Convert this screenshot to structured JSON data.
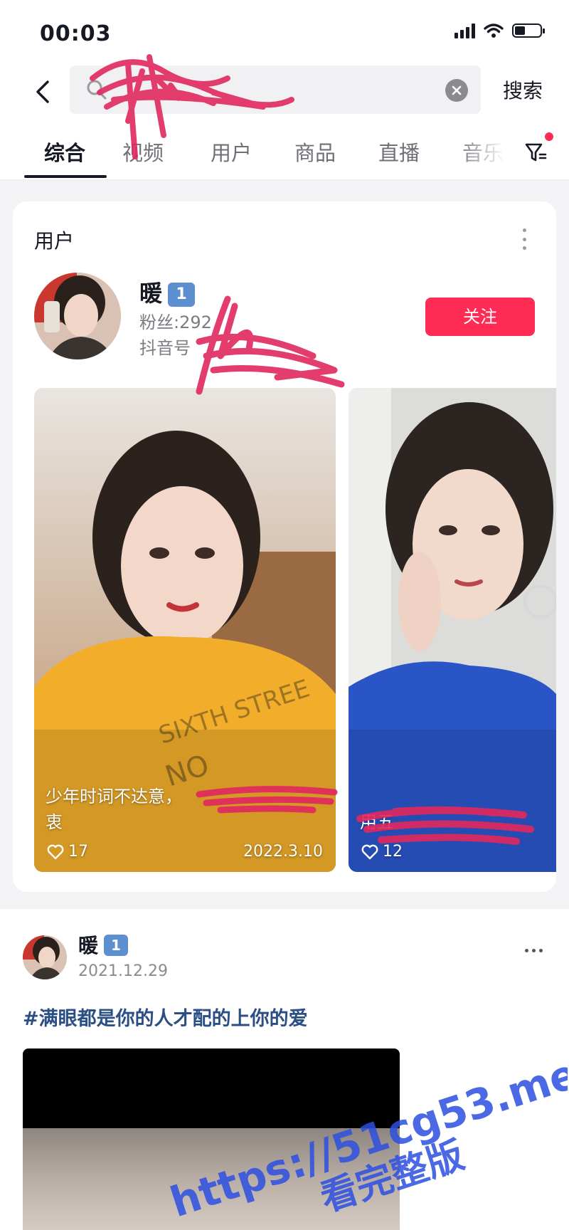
{
  "status_bar": {
    "time": "00:03"
  },
  "search": {
    "back_icon": "chevron-left-icon",
    "query": "",
    "clear_icon": "clear-icon",
    "submit_label": "搜索"
  },
  "tabs": [
    {
      "label": "综合"
    },
    {
      "label": "视频"
    },
    {
      "label": "用户"
    },
    {
      "label": "商品"
    },
    {
      "label": "直播"
    },
    {
      "label": "音乐"
    }
  ],
  "user_card": {
    "title": "用户",
    "name": "暖",
    "level": "1",
    "fans": "粉丝:292",
    "douyin_id": "抖音号",
    "follow_label": "关注",
    "videos": [
      {
        "caption": "少年时词不达意，",
        "caption2": "衷",
        "likes": "17",
        "date": "2022.3.10"
      },
      {
        "caption": "用五",
        "likes": "12"
      }
    ]
  },
  "post": {
    "author": "暖",
    "level": "1",
    "date": "2021.12.29",
    "hashtag": "#满眼都是你的人才配的上你的爱"
  },
  "watermark": {
    "url": "https://51cg53.me",
    "tagline": "看完整版"
  },
  "colors": {
    "accent": "#fe2c55",
    "badge": "#5b8fcf",
    "hashtag": "#2b4f84",
    "watermark": "#2d4fe0"
  }
}
